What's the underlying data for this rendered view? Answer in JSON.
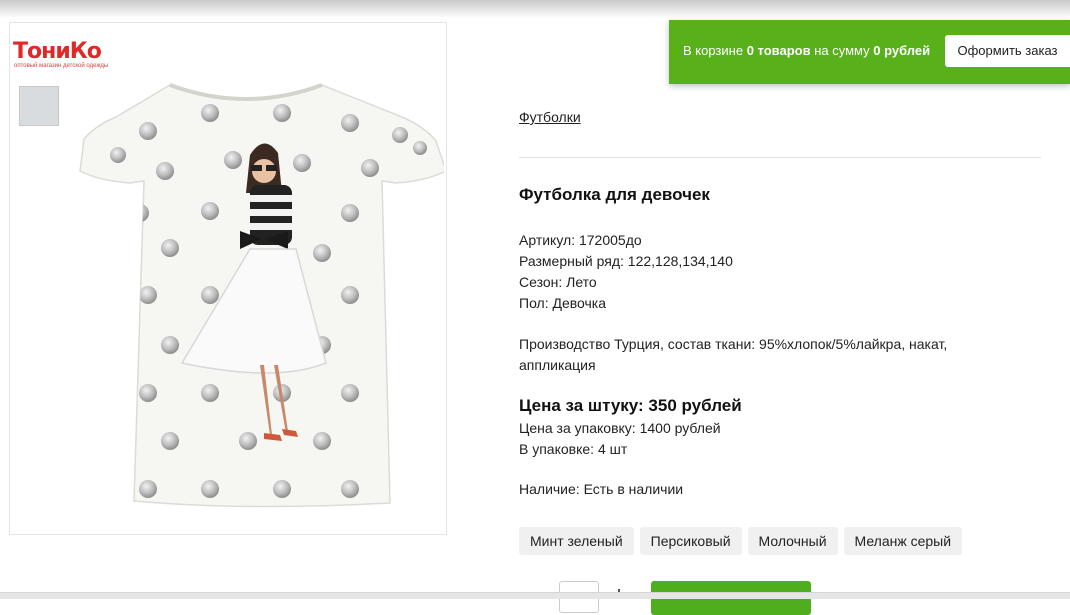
{
  "logo": {
    "brand": "ТониКо",
    "tagline": "оптовый магазин детской одежды"
  },
  "cart": {
    "prefix": "В корзине",
    "count": "0 товаров",
    "middle": "на сумму",
    "sum": "0 рублей",
    "checkout_label": "Оформить заказ"
  },
  "product": {
    "category": "Футболки",
    "title": "Футболка для девочек",
    "article": "Артикул: 172005до",
    "sizes": "Размерный ряд: 122,128,134,140",
    "season": "Сезон: Лето",
    "gender": "Пол: Девочка",
    "description": "Производство Турция, состав ткани: 95%хлопок/5%лайкра, накат, аппликация",
    "price_unit": "Цена за штуку: 350 рублей",
    "price_pack": "Цена за упаковку: 1400 рублей",
    "pack_qty": "В упаковке: 4 шт",
    "availability": "Наличие: Есть в наличии",
    "colors": [
      "Минт зеленый",
      "Персиковый",
      "Молочный",
      "Меланж серый"
    ]
  },
  "colors": {
    "accent": "#58b01a",
    "button_green": "#4fae1d",
    "chip_bg": "#f0f0f0"
  }
}
